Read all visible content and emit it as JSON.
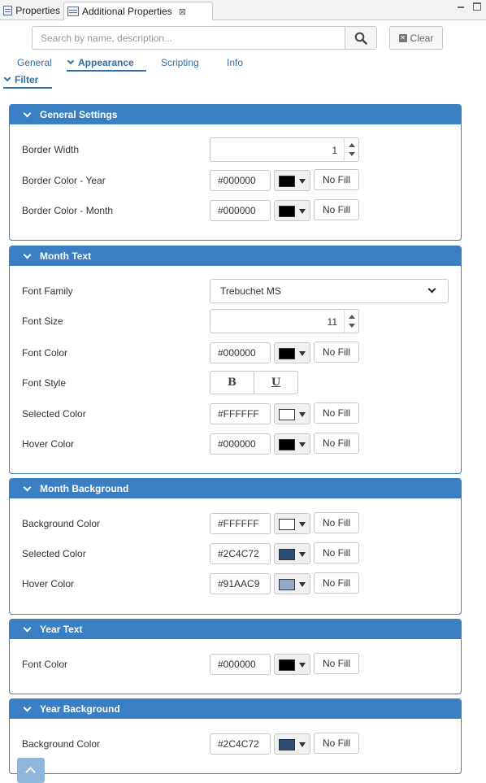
{
  "tabs": {
    "properties": "Properties",
    "additional": "Additional Properties",
    "close": "⊠"
  },
  "search": {
    "placeholder": "Search by name, description...",
    "value": "",
    "clear_label": "Clear"
  },
  "nav": {
    "general": "General",
    "appearance": "Appearance",
    "scripting": "Scripting",
    "info": "Info",
    "filter": "Filter"
  },
  "sections": {
    "general_settings": {
      "title": "General Settings",
      "border_width_label": "Border Width",
      "border_width_value": "1",
      "border_color_year_label": "Border Color - Year",
      "border_color_year_hex": "#000000",
      "border_color_month_label": "Border Color - Month",
      "border_color_month_hex": "#000000"
    },
    "month_text": {
      "title": "Month Text",
      "font_family_label": "Font Family",
      "font_family_value": "Trebuchet MS",
      "font_size_label": "Font Size",
      "font_size_value": "11",
      "font_color_label": "Font Color",
      "font_color_hex": "#000000",
      "font_style_label": "Font Style",
      "bold_label": "B",
      "underline_label": "U",
      "selected_color_label": "Selected Color",
      "selected_color_hex": "#FFFFFF",
      "hover_color_label": "Hover Color",
      "hover_color_hex": "#000000"
    },
    "month_background": {
      "title": "Month Background",
      "background_color_label": "Background Color",
      "background_color_hex": "#FFFFFF",
      "selected_color_label": "Selected Color",
      "selected_color_hex": "#2C4C72",
      "hover_color_label": "Hover Color",
      "hover_color_hex": "#91AAC9"
    },
    "year_text": {
      "title": "Year Text",
      "font_color_label": "Font Color",
      "font_color_hex": "#000000"
    },
    "year_background": {
      "title": "Year Background",
      "background_color_label": "Background Color",
      "background_color_hex": "#2C4C72"
    }
  },
  "no_fill_label": "No Fill",
  "colors": {
    "accent": "#3a7fc3",
    "link": "#2f6ea8"
  },
  "icons": {
    "search": "search-icon",
    "clear": "clear-icon",
    "scroll_top": "chevron-up-icon"
  }
}
